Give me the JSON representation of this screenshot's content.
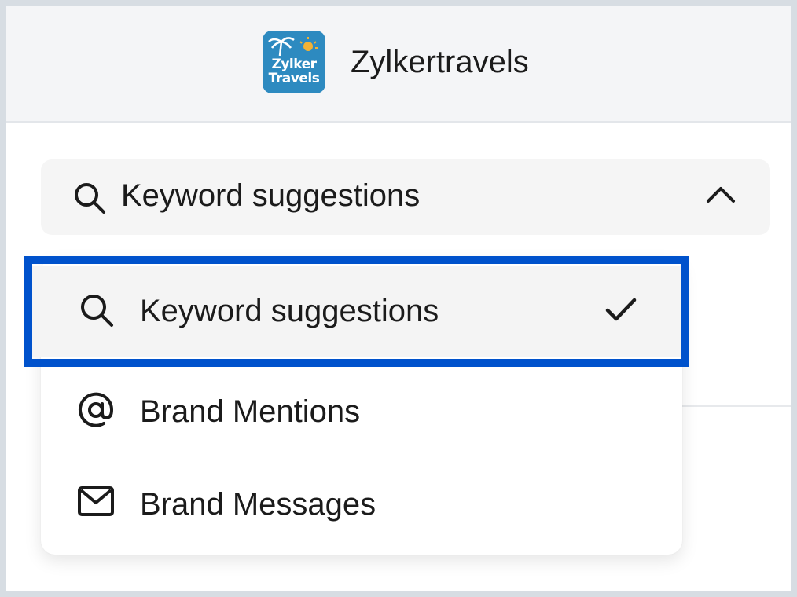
{
  "brand": {
    "logo_line1": "Zylker",
    "logo_line2": "Travels",
    "name": "Zylkertravels"
  },
  "dropdown": {
    "selected_label": "Keyword suggestions",
    "icon": "search-icon",
    "state_icon": "chevron-up-icon"
  },
  "menu": {
    "items": [
      {
        "label": "Keyword suggestions",
        "icon": "search-icon",
        "selected": true
      },
      {
        "label": "Brand Mentions",
        "icon": "at-sign-icon",
        "selected": false
      },
      {
        "label": "Brand Messages",
        "icon": "mail-icon",
        "selected": false
      }
    ]
  },
  "colors": {
    "highlight_border": "#0052cc",
    "header_bg": "#f4f5f7",
    "logo_bg": "#2d8ac0"
  }
}
